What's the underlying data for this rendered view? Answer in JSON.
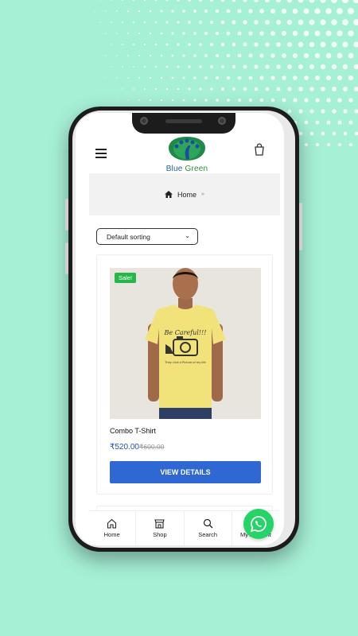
{
  "brand": {
    "name_part1": "Blue",
    "name_part2": "Green"
  },
  "breadcrumb": {
    "home_label": "Home",
    "separator": "»"
  },
  "sort": {
    "selected": "Default sorting"
  },
  "product": {
    "badge": "Sale!",
    "title": "Combo T-Shirt",
    "price_current": "₹520.00",
    "price_original": "₹600.00",
    "button_label": "VIEW DETAILS",
    "shirt_print": "Be Careful!!!",
    "shirt_print_small": "They click a Picture of my life"
  },
  "bottom_nav": {
    "home": "Home",
    "shop": "Shop",
    "search": "Search",
    "account": "My Account"
  },
  "colors": {
    "background": "#a6f0d6",
    "accent_button": "#2f67d3",
    "sale_badge": "#27b64a",
    "whatsapp": "#25d366",
    "price": "#1f4fb8"
  },
  "icons": [
    "hamburger-icon",
    "cart-icon",
    "home-icon",
    "shop-icon",
    "search-icon",
    "account-icon",
    "whatsapp-icon"
  ]
}
